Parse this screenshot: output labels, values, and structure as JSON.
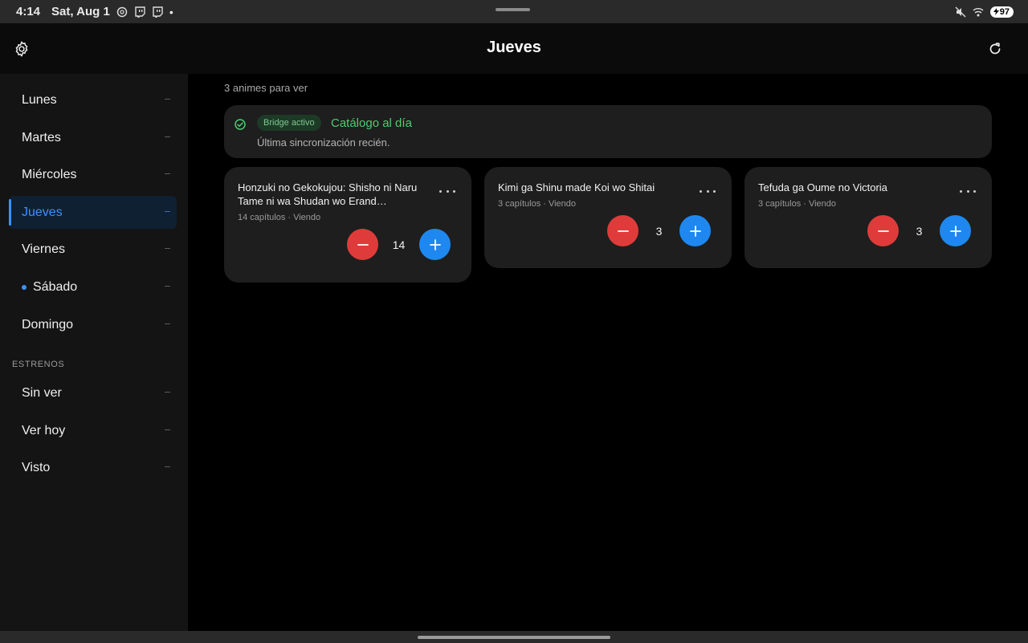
{
  "status_bar": {
    "time": "4:14",
    "date": "Sat, Aug 1",
    "dot": "•",
    "battery": "97"
  },
  "header": {
    "title": "Jueves"
  },
  "sidebar": {
    "days": [
      {
        "label": "Lunes"
      },
      {
        "label": "Martes"
      },
      {
        "label": "Miércoles"
      },
      {
        "label": "Jueves"
      },
      {
        "label": "Viernes"
      },
      {
        "label": "Sábado"
      },
      {
        "label": "Domingo"
      }
    ],
    "section_label": "ESTRENOS",
    "premieres": [
      {
        "label": "Sin ver"
      },
      {
        "label": "Ver hoy"
      },
      {
        "label": "Visto"
      }
    ]
  },
  "main": {
    "count_text": "3 animes para ver",
    "sync": {
      "pill": "Bridge activo",
      "title": "Catálogo al día",
      "subtitle": "Última sincronización recién."
    },
    "cards": [
      {
        "title": "Honzuki no Gekokujou: Shisho ni Naru Tame ni wa Shudan wo Erand…",
        "meta": "14 capítulos · Viendo",
        "value": "14"
      },
      {
        "title": "Kimi ga Shinu made Koi wo Shitai",
        "meta": "3 capítulos · Viendo",
        "value": "3"
      },
      {
        "title": "Tefuda ga Oume no Victoria",
        "meta": "3 capítulos · Viendo",
        "value": "3"
      }
    ]
  },
  "colors": {
    "accent": "#3a93ff",
    "minus": "#e03b3b",
    "plus": "#1e88f0",
    "success": "#4ecb71"
  }
}
